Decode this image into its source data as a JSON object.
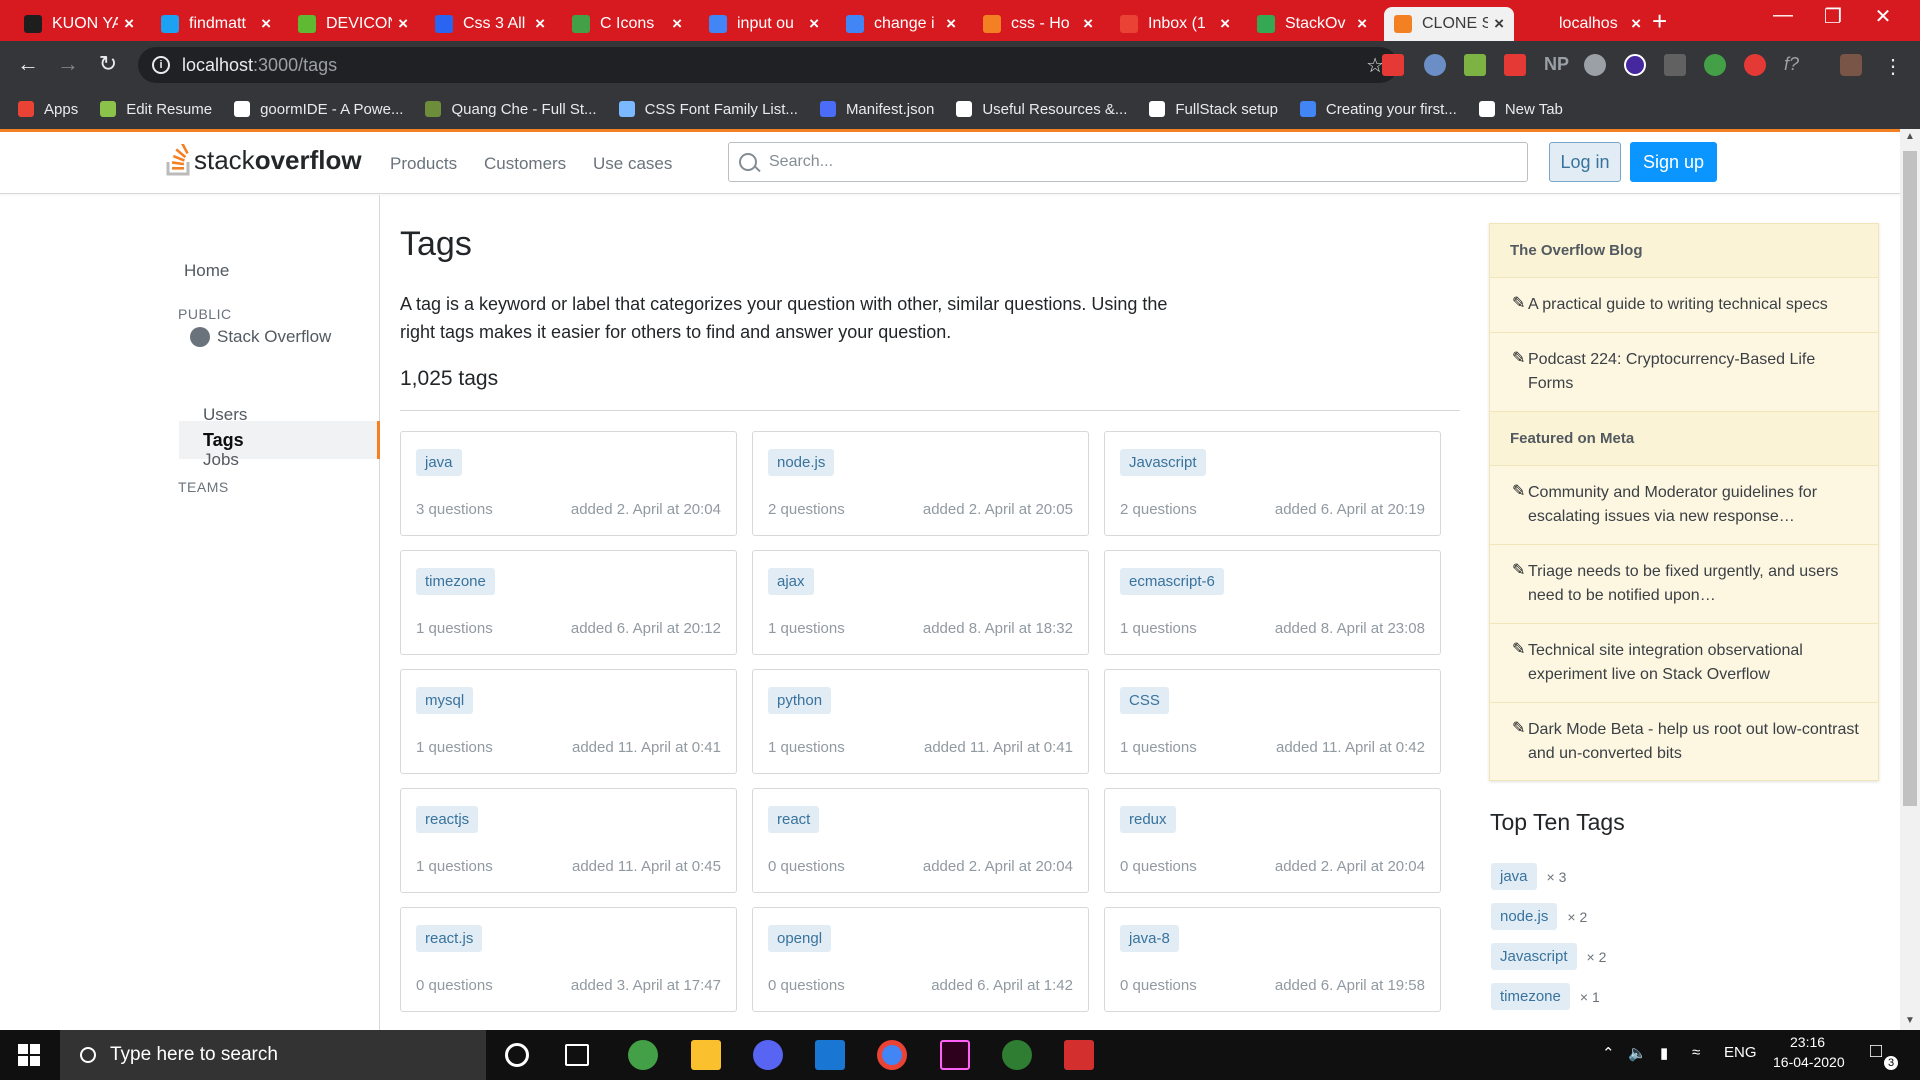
{
  "browser": {
    "tabs": [
      {
        "title": "KUON YA",
        "color": "#1e1e1e"
      },
      {
        "title": "findmatt",
        "color": "#1da1f2"
      },
      {
        "title": "DEVICON",
        "color": "#60b932"
      },
      {
        "title": "Css 3 All",
        "color": "#2965f1"
      },
      {
        "title": "C Icons",
        "color": "#43a047"
      },
      {
        "title": "input ou",
        "color": "#4285f4"
      },
      {
        "title": "change i",
        "color": "#4285f4"
      },
      {
        "title": "css - Ho",
        "color": "#f48024"
      },
      {
        "title": "Inbox (1",
        "color": "#ea4335"
      },
      {
        "title": "StackOv",
        "color": "#34a853"
      },
      {
        "title": "CLONE S",
        "color": "#f48024"
      },
      {
        "title": "localhos",
        "color": "#d71920"
      }
    ],
    "url_host": "localhost",
    "url_path": ":3000/tags",
    "bookmarks": [
      {
        "label": "Apps",
        "color": "#ea4335"
      },
      {
        "label": "Edit Resume",
        "color": "#8bc34a"
      },
      {
        "label": "goormIDE - A Powe...",
        "color": "#ffffff"
      },
      {
        "label": "Quang Che - Full St...",
        "color": "#6d8d3a"
      },
      {
        "label": "CSS Font Family List...",
        "color": "#7ab8ff"
      },
      {
        "label": "Manifest.json",
        "color": "#4a6cf7"
      },
      {
        "label": "Useful Resources &...",
        "color": "#ffffff"
      },
      {
        "label": "FullStack setup",
        "color": "#ffffff"
      },
      {
        "label": "Creating your first...",
        "color": "#4285f4"
      },
      {
        "label": "New Tab",
        "color": "#ffffff"
      }
    ]
  },
  "header": {
    "logo_light": "stack",
    "logo_bold": "overflow",
    "nav": [
      "Products",
      "Customers",
      "Use cases"
    ],
    "search_placeholder": "Search...",
    "login": "Log in",
    "signup": "Sign up"
  },
  "leftnav": {
    "home": "Home",
    "public": "PUBLIC",
    "stackoverflow": "Stack Overflow",
    "tags": "Tags",
    "users": "Users",
    "jobs": "Jobs",
    "teams": "TEAMS"
  },
  "main": {
    "title": "Tags",
    "description": "A tag is a keyword or label that categorizes your question with other, similar questions. Using the right tags makes it easier for others to find and answer your question.",
    "count": "1,025 tags",
    "tags": [
      {
        "name": "java",
        "questions": "3 questions",
        "added": "added 2. April at 20:04"
      },
      {
        "name": "node.js",
        "questions": "2 questions",
        "added": "added 2. April at 20:05"
      },
      {
        "name": "Javascript",
        "questions": "2 questions",
        "added": "added 6. April at 20:19"
      },
      {
        "name": "timezone",
        "questions": "1 questions",
        "added": "added 6. April at 20:12"
      },
      {
        "name": "ajax",
        "questions": "1 questions",
        "added": "added 8. April at 18:32"
      },
      {
        "name": "ecmascript-6",
        "questions": "1 questions",
        "added": "added 8. April at 23:08"
      },
      {
        "name": "mysql",
        "questions": "1 questions",
        "added": "added 11. April at 0:41"
      },
      {
        "name": "python",
        "questions": "1 questions",
        "added": "added 11. April at 0:41"
      },
      {
        "name": "CSS",
        "questions": "1 questions",
        "added": "added 11. April at 0:42"
      },
      {
        "name": "reactjs",
        "questions": "1 questions",
        "added": "added 11. April at 0:45"
      },
      {
        "name": "react",
        "questions": "0 questions",
        "added": "added 2. April at 20:04"
      },
      {
        "name": "redux",
        "questions": "0 questions",
        "added": "added 2. April at 20:04"
      },
      {
        "name": "react.js",
        "questions": "0 questions",
        "added": "added 3. April at 17:47"
      },
      {
        "name": "opengl",
        "questions": "0 questions",
        "added": "added 6. April at 1:42"
      },
      {
        "name": "java-8",
        "questions": "0 questions",
        "added": "added 6. April at 19:58"
      }
    ]
  },
  "sidebar": {
    "blog_heading": "The Overflow Blog",
    "blog_items": [
      "A practical guide to writing technical specs",
      "Podcast 224: Cryptocurrency-Based Life Forms"
    ],
    "meta_heading": "Featured on Meta",
    "meta_items": [
      "Community and Moderator guidelines for escalating issues via new response…",
      "Triage needs to be fixed urgently, and users need to be notified upon…",
      "Technical site integration observational experiment live on Stack Overflow",
      "Dark Mode Beta - help us root out low-contrast and un-converted bits"
    ],
    "top_ten_title": "Top Ten Tags",
    "top_ten": [
      {
        "name": "java",
        "count": "× 3"
      },
      {
        "name": "node.js",
        "count": "× 2"
      },
      {
        "name": "Javascript",
        "count": "× 2"
      },
      {
        "name": "timezone",
        "count": "× 1"
      }
    ]
  },
  "taskbar": {
    "search_placeholder": "Type here to search",
    "language": "ENG",
    "time": "23:16",
    "date": "16-04-2020",
    "notification_count": "3"
  },
  "colors": {
    "accent": "#f48024",
    "brand_blue": "#0a95ff",
    "tag_bg": "#e1ecf4",
    "tag_fg": "#39739d",
    "chrome_tabbar": "#d71920"
  }
}
